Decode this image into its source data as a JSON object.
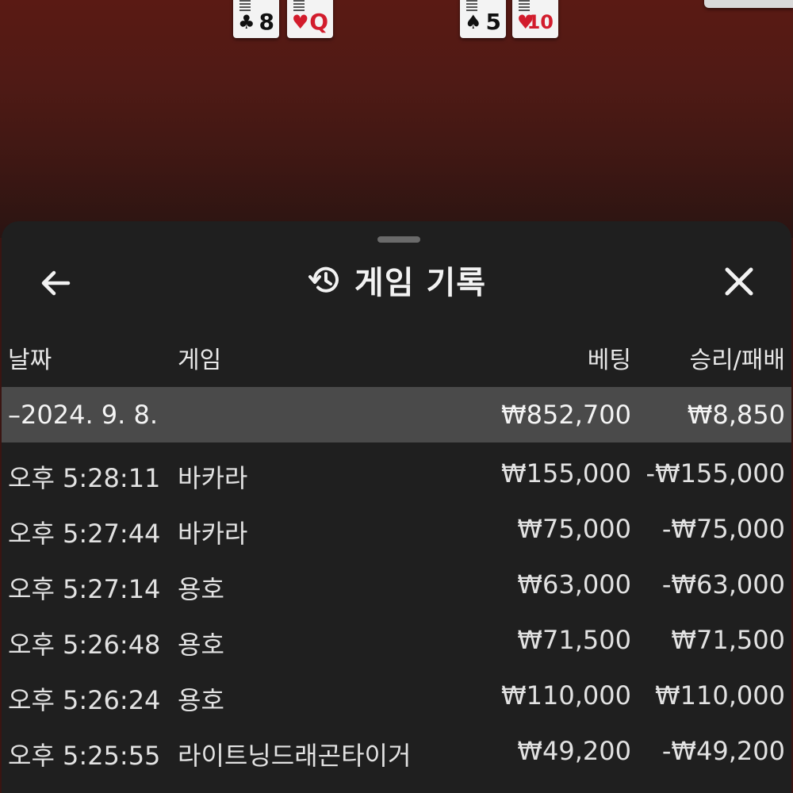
{
  "cards": [
    {
      "rank": "8",
      "suit": "♣",
      "color": "#111111"
    },
    {
      "rank": "Q",
      "suit": "♥",
      "color": "#d21c2c"
    },
    {
      "rank": "5",
      "suit": "♠",
      "color": "#111111"
    },
    {
      "rank": "10",
      "suit": "♥",
      "color": "#d21c2c"
    }
  ],
  "header": {
    "title": "게임 기록",
    "back_icon": "arrow-left-icon",
    "history_icon": "history-icon",
    "close_icon": "close-icon"
  },
  "columns": {
    "date": "날짜",
    "game": "게임",
    "bet": "베팅",
    "win_loss": "승리/패배"
  },
  "summary": {
    "date": "–2024. 9. 8.",
    "bet": "₩852,700",
    "win_loss": "₩8,850"
  },
  "rows": [
    {
      "time": "오후 5:28:11",
      "game": "바카라",
      "bet": "₩155,000",
      "win_loss": "-₩155,000"
    },
    {
      "time": "오후 5:27:44",
      "game": "바카라",
      "bet": "₩75,000",
      "win_loss": "-₩75,000"
    },
    {
      "time": "오후 5:27:14",
      "game": "용호",
      "bet": "₩63,000",
      "win_loss": "-₩63,000"
    },
    {
      "time": "오후 5:26:48",
      "game": "용호",
      "bet": "₩71,500",
      "win_loss": "₩71,500"
    },
    {
      "time": "오후 5:26:24",
      "game": "용호",
      "bet": "₩110,000",
      "win_loss": "₩110,000"
    },
    {
      "time": "오후 5:25:55",
      "game": "라이트닝드래곤타이거",
      "bet": "₩49,200",
      "win_loss": "-₩49,200"
    }
  ],
  "colors": {
    "sheet_bg": "#1f1f1f",
    "summary_bg": "#4a4a4a",
    "table_felt": "#4f1a15",
    "text": "#ececec"
  }
}
